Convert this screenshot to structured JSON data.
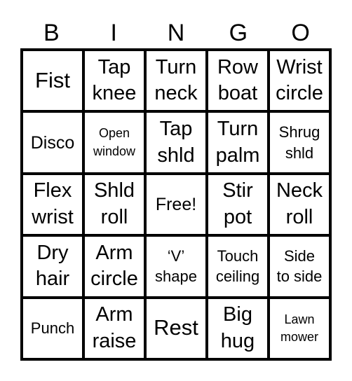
{
  "header": {
    "letters": [
      "B",
      "I",
      "N",
      "G",
      "O"
    ]
  },
  "card": {
    "rows": [
      [
        {
          "text": "Fist",
          "size": "xl"
        },
        {
          "text": "Tap\nknee",
          "size": "lg"
        },
        {
          "text": "Turn\nneck",
          "size": "lg"
        },
        {
          "text": "Row\nboat",
          "size": "lg"
        },
        {
          "text": "Wrist\ncircle",
          "size": "lg"
        }
      ],
      [
        {
          "text": "Disco",
          "size": "md"
        },
        {
          "text": "Open\nwindow",
          "size": "xs"
        },
        {
          "text": "Tap\nshld",
          "size": "lg"
        },
        {
          "text": "Turn\npalm",
          "size": "lg"
        },
        {
          "text": "Shrug\nshld",
          "size": "sm"
        }
      ],
      [
        {
          "text": "Flex\nwrist",
          "size": "lg"
        },
        {
          "text": "Shld\nroll",
          "size": "lg"
        },
        {
          "text": "Free!",
          "size": "md"
        },
        {
          "text": "Stir\npot",
          "size": "lg"
        },
        {
          "text": "Neck\nroll",
          "size": "lg"
        }
      ],
      [
        {
          "text": "Dry\nhair",
          "size": "lg"
        },
        {
          "text": "Arm\ncircle",
          "size": "lg"
        },
        {
          "text": "‘V’\nshape",
          "size": "sm"
        },
        {
          "text": "Touch\nceiling",
          "size": "sm"
        },
        {
          "text": "Side\nto side",
          "size": "sm"
        }
      ],
      [
        {
          "text": "Punch",
          "size": "sm"
        },
        {
          "text": "Arm\nraise",
          "size": "lg"
        },
        {
          "text": "Rest",
          "size": "xl"
        },
        {
          "text": "Big\nhug",
          "size": "lg"
        },
        {
          "text": "Lawn\nmower",
          "size": "xs"
        }
      ]
    ]
  }
}
